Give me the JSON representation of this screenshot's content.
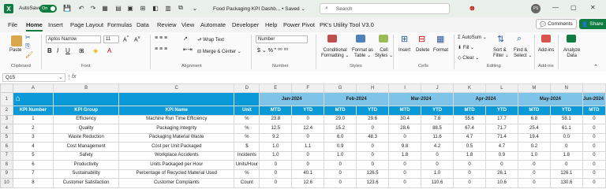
{
  "titlebar": {
    "logo": "X",
    "autosave_label": "AutoSave",
    "toggle_state": "On",
    "document_title": "Food Packaging KPI Dashb...",
    "saved_status": "• Saved",
    "search_placeholder": "Search",
    "avatar_initials": "PS"
  },
  "menu": {
    "tabs": [
      "File",
      "Home",
      "Insert",
      "Page Layout",
      "Formulas",
      "Data",
      "Review",
      "View",
      "Automate",
      "Developer",
      "Help",
      "Power Pivot",
      "PK's Utility Tool V3.0"
    ],
    "active_tab": "Home",
    "comments_label": "Comments",
    "share_label": "Share"
  },
  "ribbon": {
    "paste": "Paste",
    "clipboard": "Clipboard",
    "font_name": "Aptos Narrow",
    "font_size": "11",
    "font_group": "Font",
    "wrap_text": "Wrap Text",
    "merge_center": "Merge & Center",
    "alignment_group": "Alignment",
    "number_format": "Number",
    "number_group": "Number",
    "conditional_formatting": "Conditional Formatting",
    "format_as_table": "Format as Table",
    "cell_styles": "Cell Styles",
    "styles_group": "Styles",
    "insert": "Insert",
    "delete": "Delete",
    "format": "Format",
    "cells_group": "Cells",
    "autosum": "AutoSum",
    "fill": "Fill",
    "clear": "Clear",
    "sort_filter": "Sort & Filter",
    "find_select": "Find & Select",
    "editing_group": "Editing",
    "addins": "Add-ins",
    "addins_group": "Add-ins",
    "analyze_data": "Analyze Data"
  },
  "formula_bar": {
    "name_box": "Q15",
    "fx": "fx",
    "formula": ""
  },
  "sheet": {
    "col_letters": [
      "A",
      "B",
      "C",
      "D",
      "E",
      "F",
      "G",
      "H",
      "I",
      "J",
      "K",
      "L",
      "M",
      "N"
    ],
    "months": [
      "Jan-2024",
      "Feb-2024",
      "Mar-2024",
      "Apr-2024",
      "May-2024",
      "Jun-2024"
    ],
    "headers": [
      "KPI Number",
      "KPI Group",
      "KPI Name",
      "Unit"
    ],
    "mtd": "MTD",
    "ytd": "YTD",
    "rows": [
      {
        "n": "1",
        "group": "Efficiency",
        "name": "Machine Run Time Efficiency",
        "unit": "%",
        "v": [
          "23.8",
          "0",
          "29.0",
          "29.6",
          "30.4",
          "7.8",
          "55.6",
          "17.7",
          "6.8",
          "58.1",
          "0"
        ]
      },
      {
        "n": "2",
        "group": "Quality",
        "name": "Packaging Integrity",
        "unit": "%",
        "v": [
          "12.5",
          "12.4",
          "15.2",
          "0",
          "28.6",
          "88.5",
          "67.4",
          "71.7",
          "25.4",
          "61.1",
          "0"
        ]
      },
      {
        "n": "3",
        "group": "Waste Reduction",
        "name": "Packaging Material Waste",
        "unit": "%",
        "v": [
          "9.2",
          "0",
          "6.0",
          "48.3",
          "0",
          "11.6",
          "4.7",
          "71.4",
          "19.4",
          "0.0",
          "0"
        ]
      },
      {
        "n": "4",
        "group": "Cost Management",
        "name": "Cost per Unit Packaged",
        "unit": "$",
        "v": [
          "1.0",
          "1.1",
          "0.9",
          "0",
          "9.8",
          "4.2",
          "0.5",
          "4.7",
          "0.2",
          "0",
          "0"
        ]
      },
      {
        "n": "5",
        "group": "Safety",
        "name": "Workplace Accidents",
        "unit": "Incidents",
        "v": [
          "1.0",
          "0",
          "1.0",
          "0",
          "1.8",
          "0",
          "1.8",
          "0.9",
          "1.0",
          "1.8",
          "0"
        ]
      },
      {
        "n": "6",
        "group": "Productivity",
        "name": "Units Packaged per Hour",
        "unit": "Units/Hour",
        "v": [
          "0",
          "0",
          "0",
          "0",
          "0",
          "0",
          "0",
          "0",
          "0",
          "0",
          "0"
        ]
      },
      {
        "n": "7",
        "group": "Sustainability",
        "name": "Percentage of Recycled Material Used",
        "unit": "%",
        "v": [
          "0",
          "40.1",
          "0",
          "126.5",
          "0",
          "1.0",
          "0",
          "26.1",
          "0",
          "126.1",
          "0"
        ]
      },
      {
        "n": "8",
        "group": "Customer Satisfaction",
        "name": "Customer Complaints",
        "unit": "Count",
        "v": [
          "0",
          "12.6",
          "0",
          "123.6",
          "0",
          "110.6",
          "0",
          "10.6",
          "0",
          "130.6",
          "0"
        ]
      }
    ],
    "row_numbers": [
      "1",
      "2",
      "3",
      "4",
      "5",
      "6",
      "7",
      "8",
      "9",
      "10",
      "11"
    ]
  },
  "colors": {
    "accent": "#107c41",
    "header_blue": "#0a9ad8",
    "month_blue": "#7ec4e8"
  }
}
